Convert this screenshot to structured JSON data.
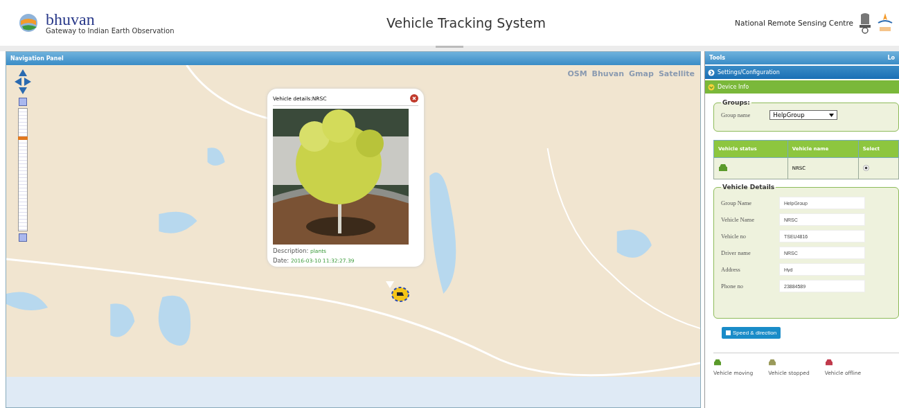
{
  "header": {
    "brand": "bhuvan",
    "tagline": "Gateway to Indian Earth Observation",
    "title": "Vehicle Tracking System",
    "org": "National Remote Sensing Centre"
  },
  "map_panel": {
    "title": "Navigation Panel",
    "layers": [
      {
        "label": "OSM"
      },
      {
        "label": "Bhuvan"
      },
      {
        "label": "Gmap"
      },
      {
        "label": "Satellite"
      }
    ],
    "zoom": {
      "level": 0.77
    },
    "popup": {
      "title": "Vehicle details:NRSC",
      "description_label": "Description:",
      "description": "plants",
      "date_label": "Date:",
      "date": "2016-03-10 11:32:27.39"
    }
  },
  "tools": {
    "title": "Tools",
    "action": "Lo",
    "sections": [
      {
        "label": "Settings/Configuration",
        "kind": "collapsed"
      },
      {
        "label": "Device Info",
        "kind": "expanded"
      }
    ],
    "groups": {
      "legend": "Groups:",
      "label": "Group name",
      "value": "HelpGroup"
    },
    "table": {
      "columns": [
        "Vehicle status",
        "Vehicle name",
        "Select"
      ],
      "rows": [
        {
          "color": "#5a9a2a",
          "name": "NRSC",
          "selected": true
        }
      ]
    },
    "details": {
      "legend": "Vehicle Details",
      "fields": [
        {
          "label": "Group Name",
          "value": "HelpGroup"
        },
        {
          "label": "Vehicle Name",
          "value": "NRSC"
        },
        {
          "label": "Vehicle no",
          "value": "TSEU4816"
        },
        {
          "label": "Driver name",
          "value": "NRSC"
        },
        {
          "label": "Address",
          "value": "Hyd"
        },
        {
          "label": "Phone no",
          "value": "23884589"
        }
      ]
    },
    "button": "Speed & direction",
    "legend": [
      {
        "label": "Vehicle moving",
        "color": "#5a9a2a"
      },
      {
        "label": "Vehicle stopped",
        "color": "#9a9a5a"
      },
      {
        "label": "Vehicle offline",
        "color": "#c0394b"
      }
    ]
  }
}
